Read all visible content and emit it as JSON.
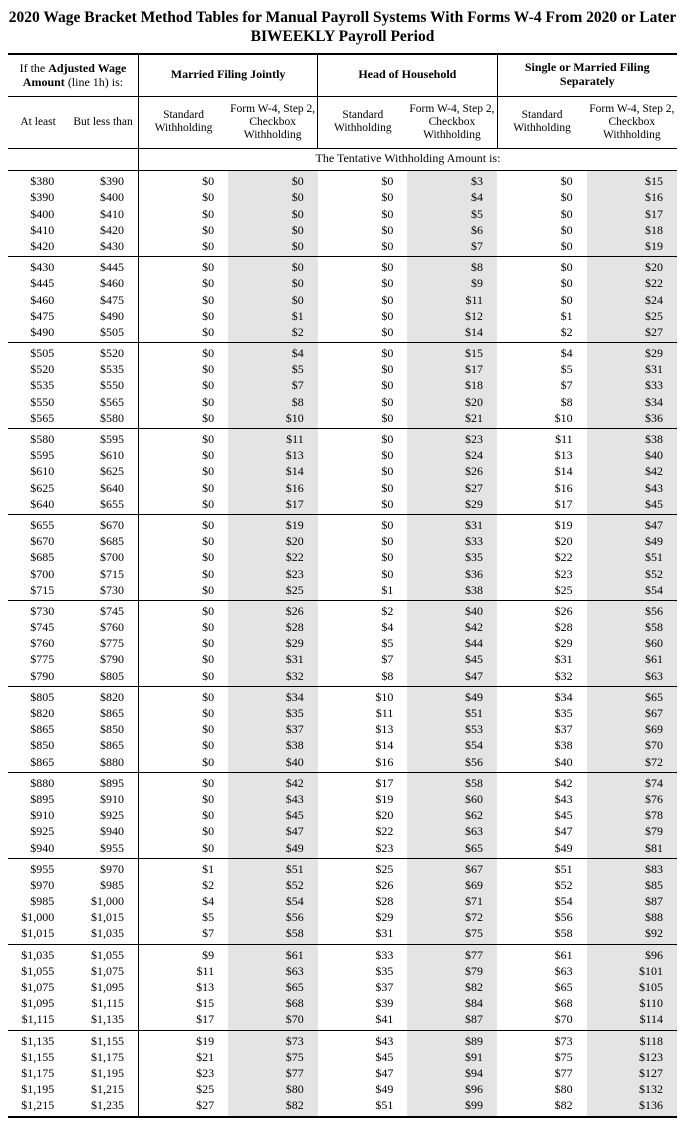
{
  "title_line1": "2020 Wage Bracket Method Tables for Manual Payroll Systems With Forms W-4 From 2020 or Later",
  "title_line2": "BIWEEKLY Payroll Period",
  "headers": {
    "adjusted_wage_html": "If the <b>Adjusted Wage Amount</b> (line 1h) is:",
    "mfj": "Married Filing Jointly",
    "hoh": "Head of Household",
    "smfs": "Single or Married Filing Separately",
    "at_least": "At least",
    "but_less_than": "But less than",
    "standard": "Standard Withholding",
    "checkbox": "Form W-4, Step 2, Checkbox Withholding",
    "tentative": "The Tentative Withholding Amount is:"
  },
  "groups": [
    [
      [
        "$380",
        "$390",
        "$0",
        "$0",
        "$0",
        "$3",
        "$0",
        "$15"
      ],
      [
        "$390",
        "$400",
        "$0",
        "$0",
        "$0",
        "$4",
        "$0",
        "$16"
      ],
      [
        "$400",
        "$410",
        "$0",
        "$0",
        "$0",
        "$5",
        "$0",
        "$17"
      ],
      [
        "$410",
        "$420",
        "$0",
        "$0",
        "$0",
        "$6",
        "$0",
        "$18"
      ],
      [
        "$420",
        "$430",
        "$0",
        "$0",
        "$0",
        "$7",
        "$0",
        "$19"
      ]
    ],
    [
      [
        "$430",
        "$445",
        "$0",
        "$0",
        "$0",
        "$8",
        "$0",
        "$20"
      ],
      [
        "$445",
        "$460",
        "$0",
        "$0",
        "$0",
        "$9",
        "$0",
        "$22"
      ],
      [
        "$460",
        "$475",
        "$0",
        "$0",
        "$0",
        "$11",
        "$0",
        "$24"
      ],
      [
        "$475",
        "$490",
        "$0",
        "$1",
        "$0",
        "$12",
        "$1",
        "$25"
      ],
      [
        "$490",
        "$505",
        "$0",
        "$2",
        "$0",
        "$14",
        "$2",
        "$27"
      ]
    ],
    [
      [
        "$505",
        "$520",
        "$0",
        "$4",
        "$0",
        "$15",
        "$4",
        "$29"
      ],
      [
        "$520",
        "$535",
        "$0",
        "$5",
        "$0",
        "$17",
        "$5",
        "$31"
      ],
      [
        "$535",
        "$550",
        "$0",
        "$7",
        "$0",
        "$18",
        "$7",
        "$33"
      ],
      [
        "$550",
        "$565",
        "$0",
        "$8",
        "$0",
        "$20",
        "$8",
        "$34"
      ],
      [
        "$565",
        "$580",
        "$0",
        "$10",
        "$0",
        "$21",
        "$10",
        "$36"
      ]
    ],
    [
      [
        "$580",
        "$595",
        "$0",
        "$11",
        "$0",
        "$23",
        "$11",
        "$38"
      ],
      [
        "$595",
        "$610",
        "$0",
        "$13",
        "$0",
        "$24",
        "$13",
        "$40"
      ],
      [
        "$610",
        "$625",
        "$0",
        "$14",
        "$0",
        "$26",
        "$14",
        "$42"
      ],
      [
        "$625",
        "$640",
        "$0",
        "$16",
        "$0",
        "$27",
        "$16",
        "$43"
      ],
      [
        "$640",
        "$655",
        "$0",
        "$17",
        "$0",
        "$29",
        "$17",
        "$45"
      ]
    ],
    [
      [
        "$655",
        "$670",
        "$0",
        "$19",
        "$0",
        "$31",
        "$19",
        "$47"
      ],
      [
        "$670",
        "$685",
        "$0",
        "$20",
        "$0",
        "$33",
        "$20",
        "$49"
      ],
      [
        "$685",
        "$700",
        "$0",
        "$22",
        "$0",
        "$35",
        "$22",
        "$51"
      ],
      [
        "$700",
        "$715",
        "$0",
        "$23",
        "$0",
        "$36",
        "$23",
        "$52"
      ],
      [
        "$715",
        "$730",
        "$0",
        "$25",
        "$1",
        "$38",
        "$25",
        "$54"
      ]
    ],
    [
      [
        "$730",
        "$745",
        "$0",
        "$26",
        "$2",
        "$40",
        "$26",
        "$56"
      ],
      [
        "$745",
        "$760",
        "$0",
        "$28",
        "$4",
        "$42",
        "$28",
        "$58"
      ],
      [
        "$760",
        "$775",
        "$0",
        "$29",
        "$5",
        "$44",
        "$29",
        "$60"
      ],
      [
        "$775",
        "$790",
        "$0",
        "$31",
        "$7",
        "$45",
        "$31",
        "$61"
      ],
      [
        "$790",
        "$805",
        "$0",
        "$32",
        "$8",
        "$47",
        "$32",
        "$63"
      ]
    ],
    [
      [
        "$805",
        "$820",
        "$0",
        "$34",
        "$10",
        "$49",
        "$34",
        "$65"
      ],
      [
        "$820",
        "$865",
        "$0",
        "$35",
        "$11",
        "$51",
        "$35",
        "$67"
      ],
      [
        "$865",
        "$850",
        "$0",
        "$37",
        "$13",
        "$53",
        "$37",
        "$69"
      ],
      [
        "$850",
        "$865",
        "$0",
        "$38",
        "$14",
        "$54",
        "$38",
        "$70"
      ],
      [
        "$865",
        "$880",
        "$0",
        "$40",
        "$16",
        "$56",
        "$40",
        "$72"
      ]
    ],
    [
      [
        "$880",
        "$895",
        "$0",
        "$42",
        "$17",
        "$58",
        "$42",
        "$74"
      ],
      [
        "$895",
        "$910",
        "$0",
        "$43",
        "$19",
        "$60",
        "$43",
        "$76"
      ],
      [
        "$910",
        "$925",
        "$0",
        "$45",
        "$20",
        "$62",
        "$45",
        "$78"
      ],
      [
        "$925",
        "$940",
        "$0",
        "$47",
        "$22",
        "$63",
        "$47",
        "$79"
      ],
      [
        "$940",
        "$955",
        "$0",
        "$49",
        "$23",
        "$65",
        "$49",
        "$81"
      ]
    ],
    [
      [
        "$955",
        "$970",
        "$1",
        "$51",
        "$25",
        "$67",
        "$51",
        "$83"
      ],
      [
        "$970",
        "$985",
        "$2",
        "$52",
        "$26",
        "$69",
        "$52",
        "$85"
      ],
      [
        "$985",
        "$1,000",
        "$4",
        "$54",
        "$28",
        "$71",
        "$54",
        "$87"
      ],
      [
        "$1,000",
        "$1,015",
        "$5",
        "$56",
        "$29",
        "$72",
        "$56",
        "$88"
      ],
      [
        "$1,015",
        "$1,035",
        "$7",
        "$58",
        "$31",
        "$75",
        "$58",
        "$92"
      ]
    ],
    [
      [
        "$1,035",
        "$1,055",
        "$9",
        "$61",
        "$33",
        "$77",
        "$61",
        "$96"
      ],
      [
        "$1,055",
        "$1,075",
        "$11",
        "$63",
        "$35",
        "$79",
        "$63",
        "$101"
      ],
      [
        "$1,075",
        "$1,095",
        "$13",
        "$65",
        "$37",
        "$82",
        "$65",
        "$105"
      ],
      [
        "$1,095",
        "$1,115",
        "$15",
        "$68",
        "$39",
        "$84",
        "$68",
        "$110"
      ],
      [
        "$1,115",
        "$1,135",
        "$17",
        "$70",
        "$41",
        "$87",
        "$70",
        "$114"
      ]
    ],
    [
      [
        "$1,135",
        "$1,155",
        "$19",
        "$73",
        "$43",
        "$89",
        "$73",
        "$118"
      ],
      [
        "$1,155",
        "$1,175",
        "$21",
        "$75",
        "$45",
        "$91",
        "$75",
        "$123"
      ],
      [
        "$1,175",
        "$1,195",
        "$23",
        "$77",
        "$47",
        "$94",
        "$77",
        "$127"
      ],
      [
        "$1,195",
        "$1,215",
        "$25",
        "$80",
        "$49",
        "$96",
        "$80",
        "$132"
      ],
      [
        "$1,215",
        "$1,235",
        "$27",
        "$82",
        "$51",
        "$99",
        "$82",
        "$136"
      ]
    ]
  ]
}
